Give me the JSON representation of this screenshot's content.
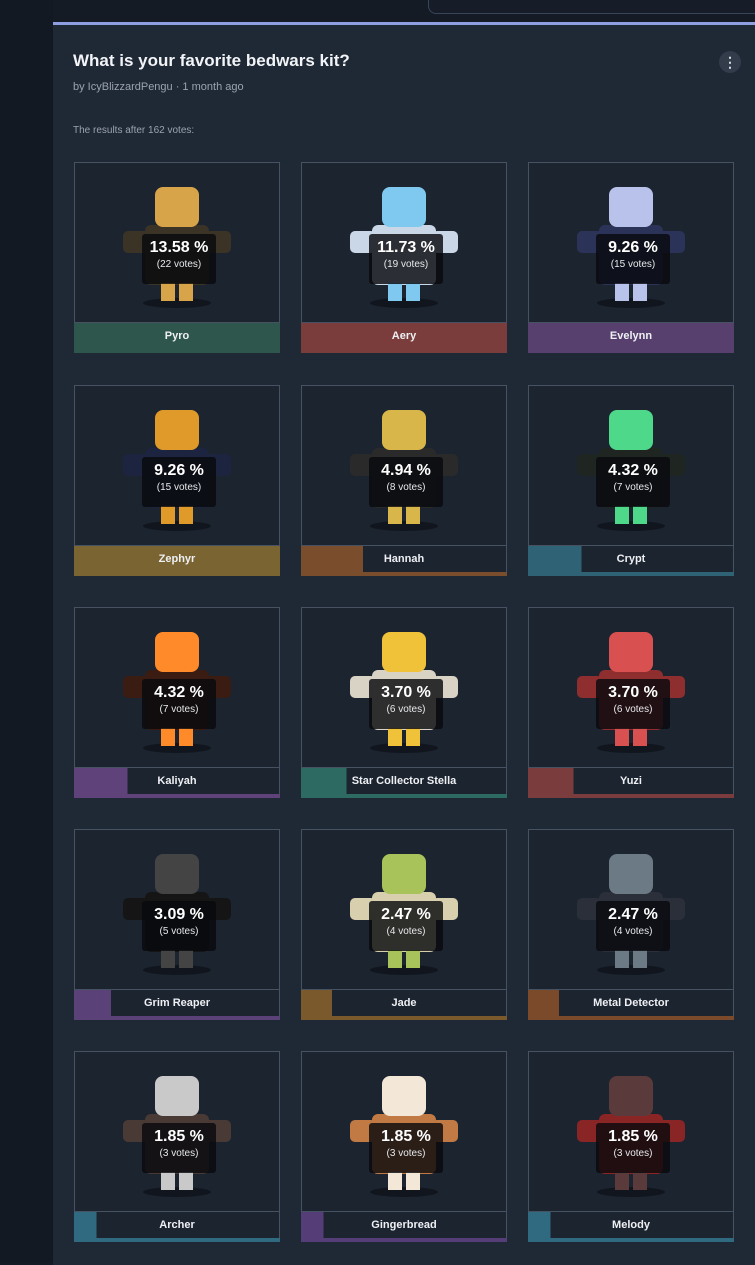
{
  "poll": {
    "title": "What is your favorite bedwars kit?",
    "byline": "by IcyBlizzardPengu · 1 month ago",
    "results_text": "The results after 162 votes:",
    "more_icon": "⋮"
  },
  "options": [
    {
      "name": "Pyro",
      "percent": "13.58 %",
      "votes": "(22 votes)",
      "color": "#2e564d",
      "fill": 1.0,
      "icon": "pyro-kit-icon"
    },
    {
      "name": "Aery",
      "percent": "11.73 %",
      "votes": "(19 votes)",
      "color": "#7a3d3c",
      "fill": 1.0,
      "icon": "aery-kit-icon"
    },
    {
      "name": "Evelynn",
      "percent": "9.26 %",
      "votes": "(15 votes)",
      "color": "#57406d",
      "fill": 1.0,
      "icon": "evelynn-kit-icon"
    },
    {
      "name": "Zephyr",
      "percent": "9.26 %",
      "votes": "(15 votes)",
      "color": "#7a6432",
      "fill": 1.0,
      "icon": "zephyr-kit-icon"
    },
    {
      "name": "Hannah",
      "percent": "4.94 %",
      "votes": "(8 votes)",
      "color": "#7a4e2c",
      "fill": 0.3,
      "icon": "hannah-kit-icon"
    },
    {
      "name": "Crypt",
      "percent": "4.32 %",
      "votes": "(7 votes)",
      "color": "#2f6275",
      "fill": 0.26,
      "icon": "crypt-kit-icon"
    },
    {
      "name": "Kaliyah",
      "percent": "4.32 %",
      "votes": "(7 votes)",
      "color": "#5e4279",
      "fill": 0.26,
      "icon": "kaliyah-kit-icon"
    },
    {
      "name": "Star Collector Stella",
      "percent": "3.70 %",
      "votes": "(6 votes)",
      "color": "#2d6b62",
      "fill": 0.22,
      "icon": "star-collector-stella-kit-icon"
    },
    {
      "name": "Yuzi",
      "percent": "3.70 %",
      "votes": "(6 votes)",
      "color": "#7a3c3c",
      "fill": 0.22,
      "icon": "yuzi-kit-icon"
    },
    {
      "name": "Grim Reaper",
      "percent": "3.09 %",
      "votes": "(5 votes)",
      "color": "#5a4279",
      "fill": 0.18,
      "icon": "grim-reaper-kit-icon"
    },
    {
      "name": "Jade",
      "percent": "2.47 %",
      "votes": "(4 votes)",
      "color": "#7a5a2d",
      "fill": 0.15,
      "icon": "jade-kit-icon"
    },
    {
      "name": "Metal Detector",
      "percent": "2.47 %",
      "votes": "(4 votes)",
      "color": "#7a4a2a",
      "fill": 0.15,
      "icon": "metal-detector-kit-icon"
    },
    {
      "name": "Archer",
      "percent": "1.85 %",
      "votes": "(3 votes)",
      "color": "#2f6a80",
      "fill": 0.11,
      "icon": "archer-kit-icon"
    },
    {
      "name": "Gingerbread",
      "percent": "1.85 %",
      "votes": "(3 votes)",
      "color": "#553e77",
      "fill": 0.11,
      "icon": "gingerbread-kit-icon"
    },
    {
      "name": "Melody",
      "percent": "1.85 %",
      "votes": "(3 votes)",
      "color": "#2f6a80",
      "fill": 0.11,
      "icon": "melody-kit-icon"
    }
  ]
}
